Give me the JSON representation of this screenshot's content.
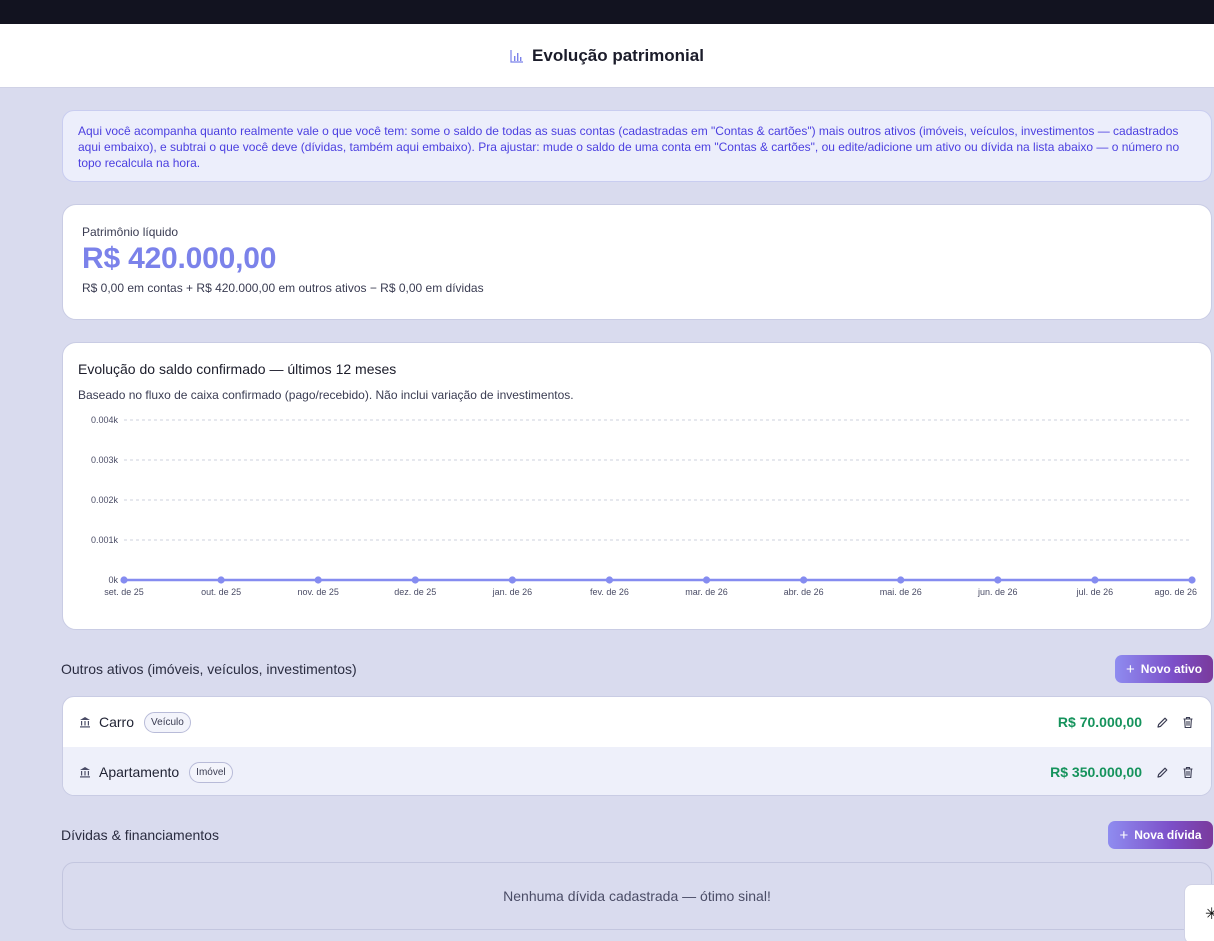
{
  "header": {
    "title": "Evolução patrimonial",
    "icon": "bar-chart-icon"
  },
  "info": {
    "text": "Aqui você acompanha quanto realmente vale o que você tem: some o saldo de todas as suas contas (cadastradas em \"Contas & cartões\") mais outros ativos (imóveis, veículos, investimentos — cadastrados aqui embaixo), e subtrai o que você deve (dívidas, também aqui embaixo). Pra ajustar: mude o saldo de uma conta em \"Contas & cartões\", ou edite/adicione um ativo ou dívida na lista abaixo — o número no topo recalcula na hora."
  },
  "net_worth": {
    "label": "Patrimônio líquido",
    "value": "R$ 420.000,00",
    "breakdown": "R$ 0,00 em contas + R$ 420.000,00 em outros ativos − R$ 0,00 em dívidas"
  },
  "chart_data": {
    "type": "line",
    "title": "Evolução do saldo confirmado — últimos 12 meses",
    "subtitle": "Baseado no fluxo de caixa confirmado (pago/recebido). Não inclui variação de investimentos.",
    "categories": [
      "set. de 25",
      "out. de 25",
      "nov. de 25",
      "dez. de 25",
      "jan. de 26",
      "fev. de 26",
      "mar. de 26",
      "abr. de 26",
      "mai. de 26",
      "jun. de 26",
      "jul. de 26",
      "ago. de 26"
    ],
    "series": [
      {
        "values": [
          0,
          0,
          0,
          0,
          0,
          0,
          0,
          0,
          0,
          0,
          0,
          0
        ]
      }
    ],
    "yticks": [
      0,
      0.001,
      0.002,
      0.003,
      0.004
    ],
    "ytick_labels": [
      "0k",
      "0.001k",
      "0.002k",
      "0.003k",
      "0.004k"
    ],
    "ylim": [
      0,
      0.004
    ],
    "grid": true,
    "line_color": "#858cf0"
  },
  "assets": {
    "section_title": "Outros ativos (imóveis, veículos, investimentos)",
    "add_button": "Novo ativo",
    "items": [
      {
        "name": "Carro",
        "type": "Veículo",
        "value": "R$ 70.000,00"
      },
      {
        "name": "Apartamento",
        "type": "Imóvel",
        "value": "R$ 350.000,00"
      }
    ]
  },
  "debts": {
    "section_title": "Dívidas & financiamentos",
    "add_button": "Nova dívida",
    "empty_text": "Nenhuma dívida cadastrada — ótimo sinal!"
  },
  "floating": {
    "glyph": "✳"
  },
  "colors": {
    "accent": "#7b82ea",
    "positive": "#15935c",
    "info_text": "#4b3fe0",
    "background": "#d9dbee"
  }
}
